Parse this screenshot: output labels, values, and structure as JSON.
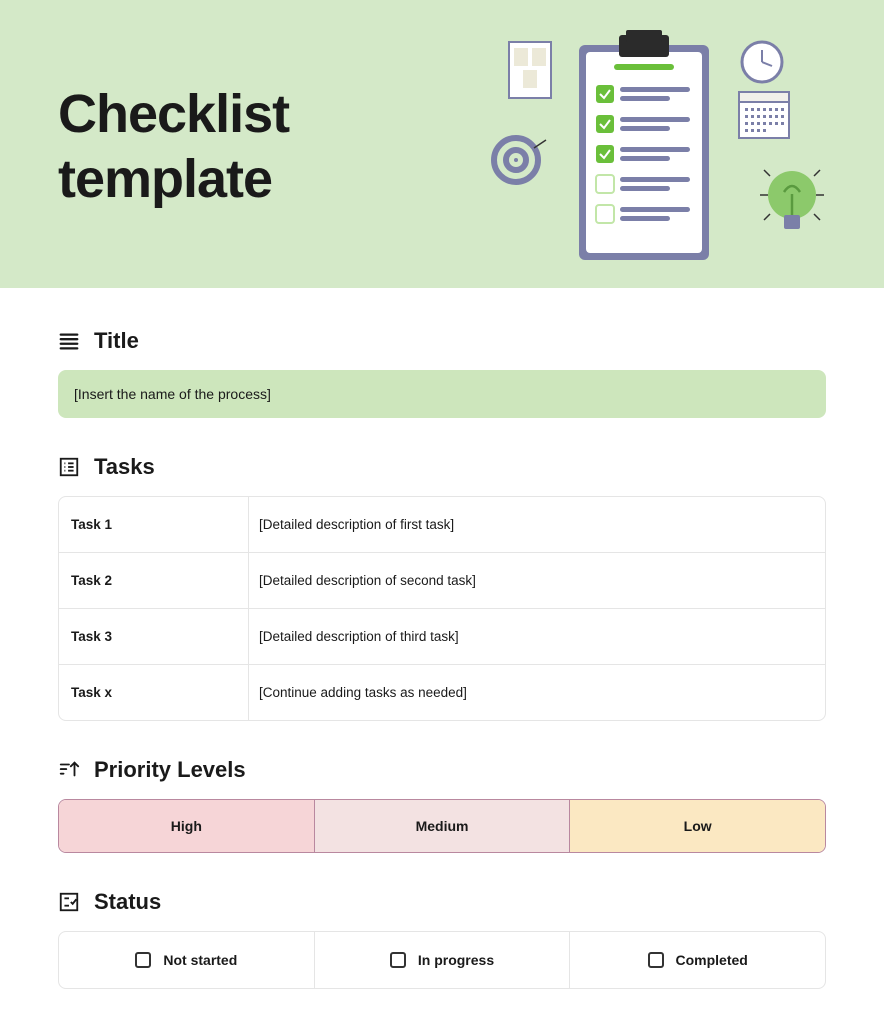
{
  "hero": {
    "title_line1": "Checklist",
    "title_line2": "template"
  },
  "sections": {
    "title": {
      "heading": "Title",
      "placeholder": "[Insert the name of the process]"
    },
    "tasks": {
      "heading": "Tasks",
      "rows": [
        {
          "name": "Task 1",
          "desc": "[Detailed description of first task]"
        },
        {
          "name": "Task 2",
          "desc": "[Detailed description of second task]"
        },
        {
          "name": "Task 3",
          "desc": "[Detailed description of third task]"
        },
        {
          "name": "Task x",
          "desc": "[Continue adding tasks as needed]"
        }
      ]
    },
    "priority": {
      "heading": "Priority Levels",
      "levels": [
        "High",
        "Medium",
        "Low"
      ]
    },
    "status": {
      "heading": "Status",
      "states": [
        "Not started",
        "In progress",
        "Completed"
      ]
    }
  }
}
